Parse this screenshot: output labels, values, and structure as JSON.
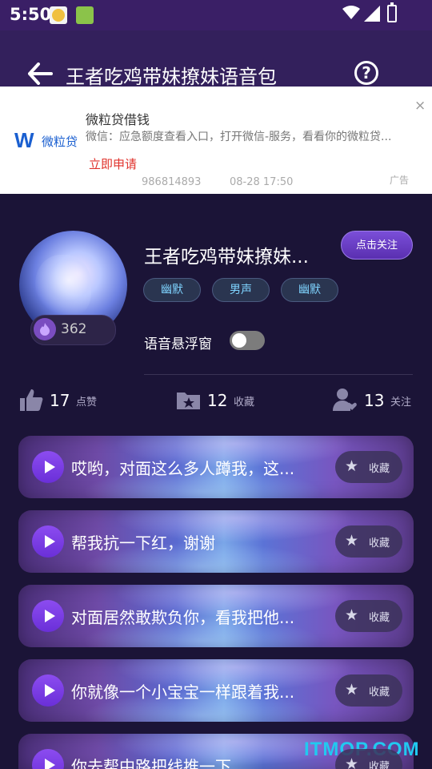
{
  "status_bar": {
    "time": "5:50"
  },
  "header": {
    "title": "王者吃鸡带妹撩妹语音包"
  },
  "ad": {
    "brand": "微粒贷",
    "title": "微粒贷借钱",
    "description": "微信：应急额度查看入口，打开微信-服务，看看你的微粒贷...",
    "cta": "立即申请",
    "id": "986814893",
    "time": "08-28 17:50",
    "label": "广告",
    "close_symbol": "×"
  },
  "profile": {
    "name": "王者吃鸡带妹撩妹...",
    "heat": "362",
    "follow_label": "点击关注",
    "tags": [
      "幽默",
      "男声",
      "幽默"
    ],
    "float_window_label": "语音悬浮窗",
    "float_window_on": false
  },
  "stats": [
    {
      "count": "17",
      "label": "点赞",
      "icon": "thumbs-up-icon"
    },
    {
      "count": "12",
      "label": "收藏",
      "icon": "folder-star-icon"
    },
    {
      "count": "13",
      "label": "关注",
      "icon": "user-heart-icon"
    }
  ],
  "clips": [
    {
      "text": "哎哟，对面这么多人蹲我，这...",
      "collect_label": "收藏"
    },
    {
      "text": "帮我抗一下红，谢谢",
      "collect_label": "收藏"
    },
    {
      "text": "对面居然敢欺负你，看我把他...",
      "collect_label": "收藏"
    },
    {
      "text": "你就像一个小宝宝一样跟着我...",
      "collect_label": "收藏"
    },
    {
      "text": "你去帮中路把线推一下",
      "collect_label": "收藏"
    }
  ],
  "watermark": "ITMOP.COM",
  "colors": {
    "accent": "#7a4ed8",
    "tag_text": "#7fd4ff",
    "ad_cta": "#e0322c",
    "watermark": "#21c9f0"
  }
}
